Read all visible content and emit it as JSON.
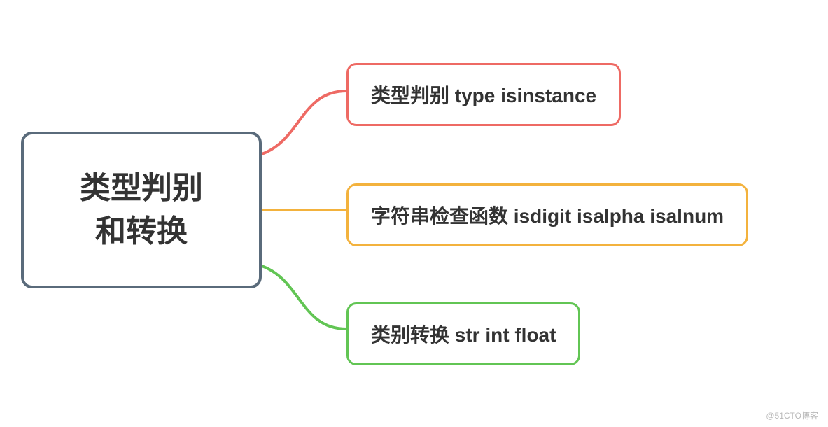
{
  "root": {
    "line1": "类型判别",
    "line2": "和转换"
  },
  "children": [
    {
      "label": "类型判别 type isinstance",
      "color": "red"
    },
    {
      "label": "字符串检查函数  isdigit isalpha isalnum",
      "color": "yellow"
    },
    {
      "label": "类别转换 str int float",
      "color": "green"
    }
  ],
  "colors": {
    "root_border": "#5a6b7b",
    "red": "#ee6a64",
    "yellow": "#f3b23d",
    "green": "#62c554"
  },
  "watermark": "@51CTO博客"
}
